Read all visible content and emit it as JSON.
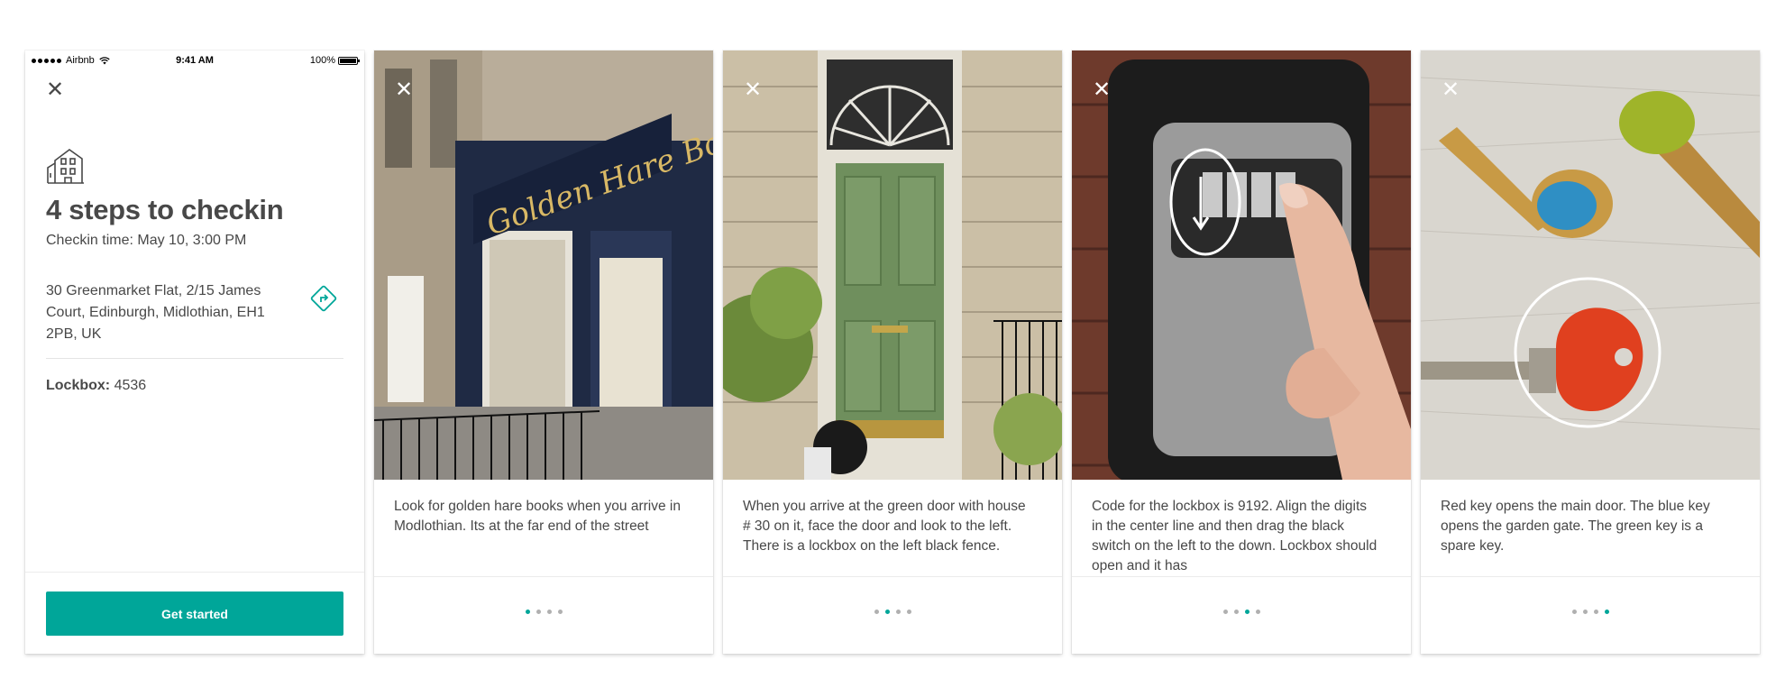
{
  "accent_color": "#00a699",
  "status_bar": {
    "carrier": "Airbnb",
    "time": "9:41 AM",
    "battery": "100%"
  },
  "intro": {
    "close_icon": "close-icon",
    "illustration_icon": "building-icon",
    "title": "4 steps to checkin",
    "checkin_time": "Checkin time: May 10, 3:00 PM",
    "address": "30 Greenmarket Flat, 2/15 James Court, Edinburgh, Midlothian, EH1 2PB, UK",
    "directions_icon": "directions-icon",
    "lockbox_label": "Lockbox:",
    "lockbox_value": "4536",
    "cta_label": "Get started"
  },
  "steps": [
    {
      "photo": "bookshop-storefront-photo",
      "caption": "Look for golden hare books when you arrive in Modlothian. Its at the far end of the street",
      "page_index": 1
    },
    {
      "photo": "green-door-photo",
      "caption": "When you arrive at the green door with house # 30 on it, face the door and look to the left. There is a lockbox on the left black fence.",
      "page_index": 2
    },
    {
      "photo": "lockbox-photo",
      "caption": "Code for the lockbox is 9192. Align the digits in the center line and then drag the black switch on the left to the down. Lockbox should open and it has",
      "page_index": 3
    },
    {
      "photo": "keys-photo",
      "caption": "Red key opens the main door. The blue key opens the garden gate. The green key is a spare key.",
      "page_index": 4
    }
  ],
  "page_count": 4
}
